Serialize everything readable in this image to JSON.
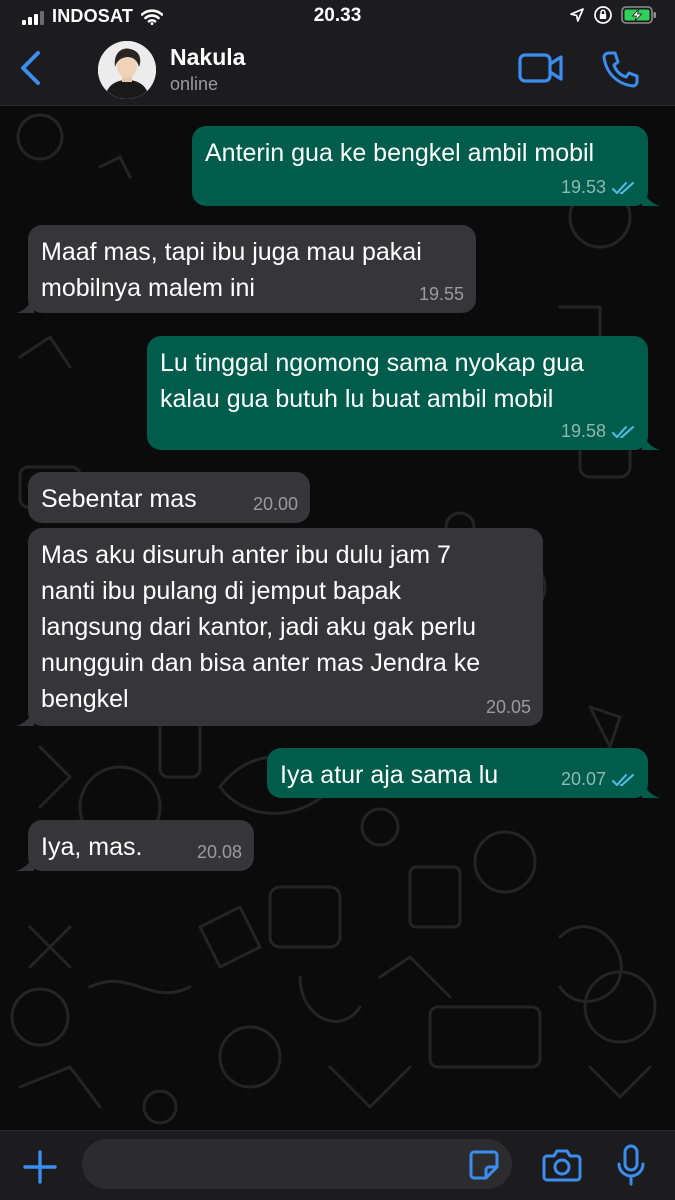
{
  "status_bar": {
    "carrier": "INDOSAT",
    "time": "20.33",
    "icons": [
      "signal-icon",
      "wifi-icon",
      "location-icon",
      "orientation-lock-icon",
      "battery-charging-icon"
    ]
  },
  "header": {
    "contact_name": "Nakula",
    "contact_status": "online",
    "icons": [
      "back-chevron-icon",
      "avatar",
      "video-call-icon",
      "phone-icon"
    ]
  },
  "messages": [
    {
      "direction": "out",
      "text": "Anterin gua ke bengkel ambil mobil",
      "time": "19.53",
      "read": true
    },
    {
      "direction": "in",
      "text": "Maaf mas, tapi ibu juga mau pakai\nmobilnya malem ini",
      "time": "19.55"
    },
    {
      "direction": "out",
      "text": "Lu tinggal ngomong sama nyokap gua\nkalau gua butuh lu buat ambil mobil",
      "time": "19.58",
      "read": true
    },
    {
      "direction": "in",
      "text": "Sebentar mas",
      "time": "20.00"
    },
    {
      "direction": "in",
      "text": "Mas aku disuruh anter ibu dulu jam 7\nnanti ibu pulang di jemput bapak\nlangsung dari kantor, jadi aku gak perlu\nnungguin dan bisa anter mas Jendra ke\nbengkel",
      "time": "20.05"
    },
    {
      "direction": "out",
      "text": "Iya atur aja sama lu",
      "time": "20.07",
      "read": true
    },
    {
      "direction": "in",
      "text": "Iya, mas.",
      "time": "20.08"
    }
  ],
  "input_bar": {
    "placeholder": "",
    "icons": [
      "plus-icon",
      "sticker-icon",
      "camera-icon",
      "microphone-icon"
    ]
  },
  "colors": {
    "accent_blue": "#3b8ef0",
    "incoming_bubble": "#363638",
    "outgoing_bubble": "#005c4b",
    "bar_background": "#1c1c1e",
    "read_ticks": "#53bdeb"
  }
}
